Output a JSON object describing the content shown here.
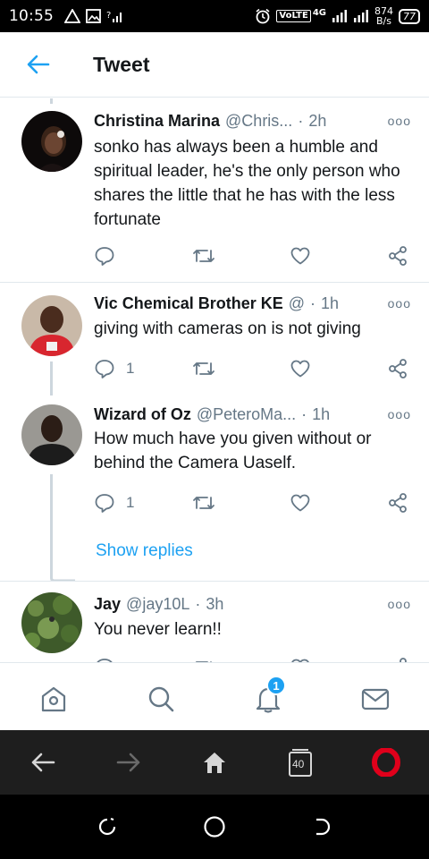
{
  "status_bar": {
    "time": "10:55",
    "network_label": "VoLTE",
    "network_gen": "4G",
    "speed_value": "874",
    "speed_unit": "B/s",
    "battery": "77"
  },
  "header": {
    "title": "Tweet"
  },
  "tweets": [
    {
      "name": "Christina Marina",
      "handle": "@Chris...",
      "time": "2h",
      "text": "sonko has always been a humble and spiritual leader, he's the only person who shares the little that he has with the less fortunate",
      "reply_count": ""
    },
    {
      "name": "Vic Chemical Brother KE",
      "handle": "@",
      "time": "1h",
      "text": "giving with cameras on is not giving",
      "reply_count": "1"
    },
    {
      "name": "Wizard of Oz",
      "handle": "@PeteroMa...",
      "time": "1h",
      "text": "How much have you given without or behind the Camera Uaself.",
      "reply_count": "1"
    },
    {
      "name": "Jay",
      "handle": "@jay10L",
      "time": "3h",
      "text": "You never learn!!",
      "reply_count": ""
    }
  ],
  "show_replies": "Show replies",
  "tab_bar": {
    "notification_badge": "1"
  },
  "browser_bar": {
    "tab_count": "40"
  },
  "colors": {
    "accent": "#1da1f2",
    "text": "#14171a",
    "muted": "#657786",
    "divider": "#e1e8ed",
    "opera_red": "#e0001b"
  }
}
